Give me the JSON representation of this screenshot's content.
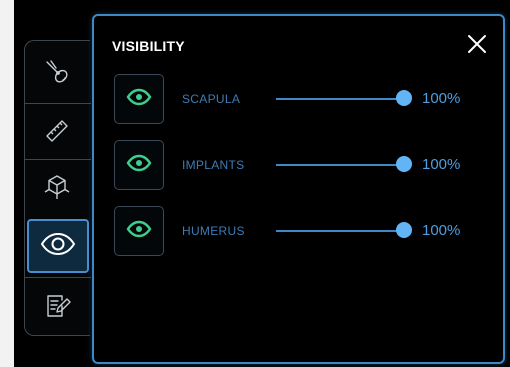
{
  "toolbar": {
    "tools": [
      {
        "name": "pliers-icon",
        "active": false
      },
      {
        "name": "ruler-icon",
        "active": false
      },
      {
        "name": "model-axes-icon",
        "active": false
      },
      {
        "name": "eye-icon",
        "active": true
      },
      {
        "name": "notes-icon",
        "active": false
      }
    ]
  },
  "panel": {
    "title": "VISIBILITY",
    "close_icon": "close-icon",
    "rows": [
      {
        "label": "SCAPULA",
        "value": "100%",
        "level": 1.0,
        "icon": "eye-icon"
      },
      {
        "label": "IMPLANTS",
        "value": "100%",
        "level": 1.0,
        "icon": "eye-icon"
      },
      {
        "label": "HUMERUS",
        "value": "100%",
        "level": 1.0,
        "icon": "eye-icon"
      }
    ]
  },
  "colors": {
    "accent": "#3d89c7",
    "thumb": "#62b4f5",
    "eye": "#3ecf8e",
    "label": "#3f7bb3",
    "value": "#4f9edf",
    "background": "#000000"
  }
}
